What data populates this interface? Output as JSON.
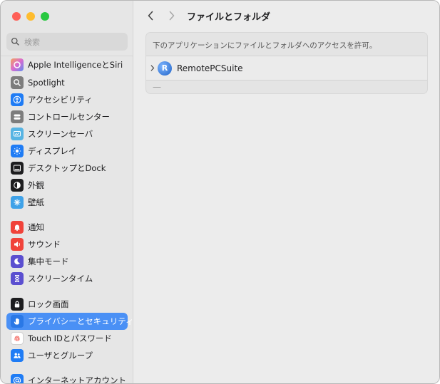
{
  "search": {
    "placeholder": "検索"
  },
  "sidebar": {
    "items": [
      {
        "label": "Apple IntelligenceとSiri",
        "icon": "apple-intelligence-icon",
        "color": "#e4a0c8"
      },
      {
        "label": "Spotlight",
        "icon": "spotlight-icon",
        "color": "#7d7d7d"
      },
      {
        "label": "アクセシビリティ",
        "icon": "accessibility-icon",
        "color": "#1f7cf5"
      },
      {
        "label": "コントロールセンター",
        "icon": "control-center-icon",
        "color": "#7d7d7d"
      },
      {
        "label": "スクリーンセーバ",
        "icon": "screen-saver-icon",
        "color": "#57b4e3"
      },
      {
        "label": "ディスプレイ",
        "icon": "display-icon",
        "color": "#1f7cf5"
      },
      {
        "label": "デスクトップとDock",
        "icon": "dock-icon",
        "color": "#1d1d1f"
      },
      {
        "label": "外観",
        "icon": "appearance-icon",
        "color": "#1d1d1f"
      },
      {
        "label": "壁紙",
        "icon": "wallpaper-icon",
        "color": "#3fa2e8"
      },
      {
        "label": "通知",
        "icon": "notifications-icon",
        "color": "#f0433a"
      },
      {
        "label": "サウンド",
        "icon": "sound-icon",
        "color": "#f0433a"
      },
      {
        "label": "集中モード",
        "icon": "focus-icon",
        "color": "#5b4fd0"
      },
      {
        "label": "スクリーンタイム",
        "icon": "screen-time-icon",
        "color": "#5b4fd0"
      },
      {
        "label": "ロック画面",
        "icon": "lock-screen-icon",
        "color": "#1d1d1f"
      },
      {
        "label": "プライバシーとセキュリティ",
        "icon": "privacy-hand-icon",
        "color": "#1f7cf5"
      },
      {
        "label": "Touch IDとパスワード",
        "icon": "touch-id-icon",
        "color": "#ffffff"
      },
      {
        "label": "ユーザとグループ",
        "icon": "users-groups-icon",
        "color": "#1f7cf5"
      },
      {
        "label": "インターネットアカウント",
        "icon": "internet-accounts-icon",
        "color": "#1f7cf5"
      }
    ]
  },
  "main": {
    "title": "ファイルとフォルダ",
    "description": "下のアプリケーションにファイルとフォルダへのアクセスを許可。",
    "app": {
      "name": "RemotePCSuite",
      "icon": "remotepcsuite-icon",
      "icon_letter": "R"
    },
    "remove_label": "—"
  }
}
